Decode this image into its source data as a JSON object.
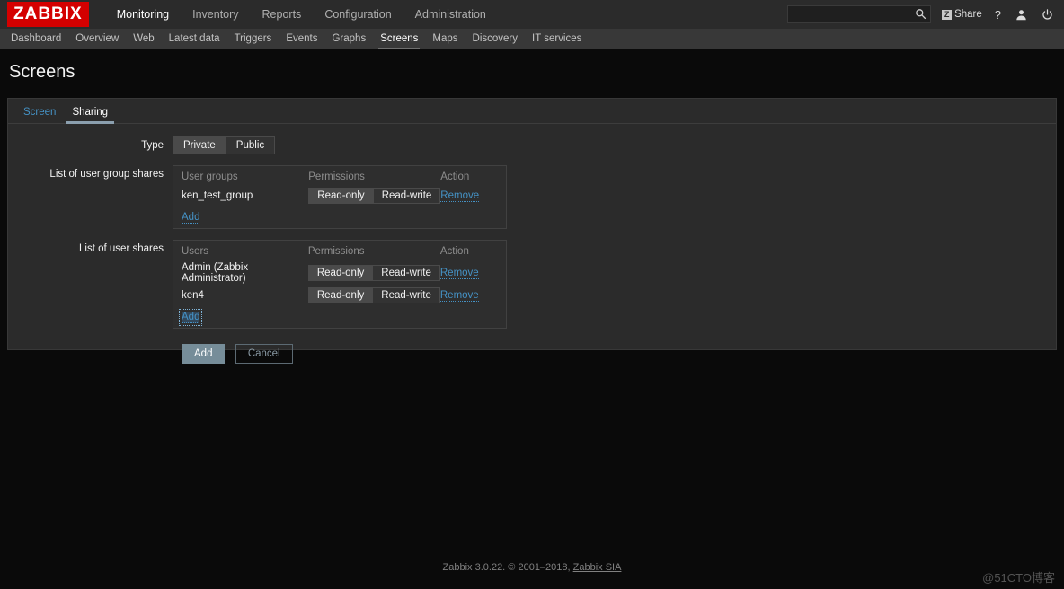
{
  "header": {
    "logo": "ZABBIX",
    "main_nav": [
      {
        "label": "Monitoring",
        "active": true
      },
      {
        "label": "Inventory",
        "active": false
      },
      {
        "label": "Reports",
        "active": false
      },
      {
        "label": "Configuration",
        "active": false
      },
      {
        "label": "Administration",
        "active": false
      }
    ],
    "search": {
      "value": "",
      "placeholder": ""
    },
    "share_label": "Share",
    "share_glyph": "Z",
    "help_label": "?",
    "icons": [
      "search-icon",
      "share-icon",
      "help-icon",
      "user-icon",
      "power-icon"
    ]
  },
  "subnav": {
    "items": [
      {
        "label": "Dashboard",
        "active": false
      },
      {
        "label": "Overview",
        "active": false
      },
      {
        "label": "Web",
        "active": false
      },
      {
        "label": "Latest data",
        "active": false
      },
      {
        "label": "Triggers",
        "active": false
      },
      {
        "label": "Events",
        "active": false
      },
      {
        "label": "Graphs",
        "active": false
      },
      {
        "label": "Screens",
        "active": true
      },
      {
        "label": "Maps",
        "active": false
      },
      {
        "label": "Discovery",
        "active": false
      },
      {
        "label": "IT services",
        "active": false
      }
    ]
  },
  "page": {
    "title": "Screens"
  },
  "tabs": [
    {
      "label": "Screen",
      "active": false
    },
    {
      "label": "Sharing",
      "active": true
    }
  ],
  "form": {
    "type": {
      "label": "Type",
      "options": [
        "Private",
        "Public"
      ],
      "selected": "Private"
    },
    "user_group_shares": {
      "label": "List of user group shares",
      "columns": [
        "User groups",
        "Permissions",
        "Action"
      ],
      "permission_options": [
        "Read-only",
        "Read-write"
      ],
      "rows": [
        {
          "name": "ken_test_group",
          "permission": "Read-only",
          "action": "Remove"
        }
      ],
      "add_label": "Add",
      "add_focused": false
    },
    "user_shares": {
      "label": "List of user shares",
      "columns": [
        "Users",
        "Permissions",
        "Action"
      ],
      "permission_options": [
        "Read-only",
        "Read-write"
      ],
      "rows": [
        {
          "name": "Admin (Zabbix Administrator)",
          "permission": "Read-only",
          "action": "Remove"
        },
        {
          "name": "ken4",
          "permission": "Read-only",
          "action": "Remove"
        }
      ],
      "add_label": "Add",
      "add_focused": true
    },
    "buttons": {
      "submit": "Add",
      "cancel": "Cancel"
    }
  },
  "footer": {
    "text": "Zabbix 3.0.22. © 2001–2018, ",
    "link": "Zabbix SIA",
    "watermark": "@51CTO博客"
  },
  "colors": {
    "brand_red": "#d40000",
    "link_blue": "#4592c5",
    "panel_bg": "#2b2b2b",
    "topbar_bg": "#2b2b2b",
    "subnav_bg": "#383838",
    "primary_button": "#768d99"
  }
}
